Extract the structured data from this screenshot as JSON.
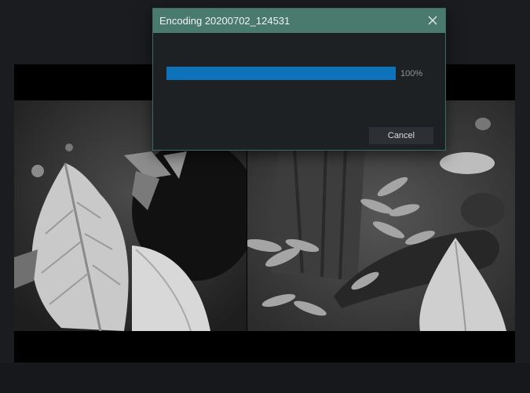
{
  "dialog": {
    "title": "Encoding 20200702_124531",
    "progress_percent": 100,
    "progress_text": "100%",
    "cancel_label": "Cancel",
    "close_icon": "close-icon"
  },
  "colors": {
    "title_bar": "#4a7a6e",
    "progress_fill": "#0e72bb",
    "background": "#1b1c1f"
  }
}
